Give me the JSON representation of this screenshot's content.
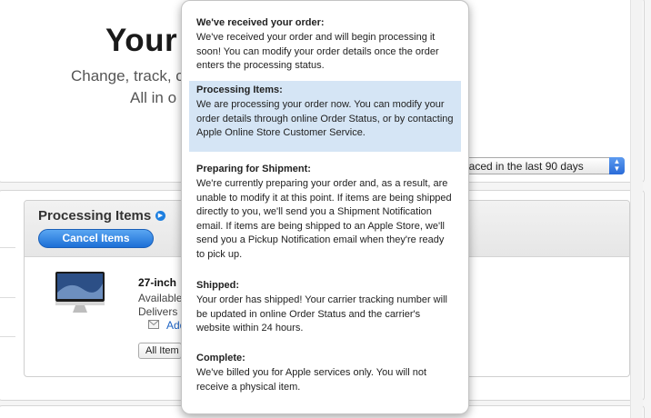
{
  "header": {
    "title": "Your O",
    "subtitle_line1": "Change, track, c",
    "subtitle_line2": "All in o",
    "filter_value": "laced in the last 90 days"
  },
  "order": {
    "status_title": "Processing Items",
    "cancel_label": "Cancel Items",
    "product_name": "27-inch",
    "availability": "Available",
    "delivers": "Delivers",
    "address_link": "Add",
    "items_select": "All Item"
  },
  "popover": {
    "sections": [
      {
        "heading": "We've received your order:",
        "text": "We've received your order and will begin processing it soon! You can modify your order details once the order enters the processing status."
      },
      {
        "heading": "Processing Items:",
        "text": "We are processing your order now. You can modify your order details through online Order Status, or by contacting Apple Online Store Customer Service."
      },
      {
        "heading": "Preparing for Shipment:",
        "text": "We're currently preparing your order and, as a result, are unable to modify it at this point. If items are being shipped directly to you, we'll send you a Shipment Notification email. If items are being shipped to an Apple Store, we'll send you a Pickup Notification email when they're ready to pick up."
      },
      {
        "heading": "Shipped:",
        "text": "Your order has shipped! Your carrier tracking number will be updated in online Order Status and the carrier's website within 24 hours."
      },
      {
        "heading": "Complete:",
        "text": "We've billed you for Apple services only. You will not receive a physical item."
      }
    ]
  },
  "colors": {
    "accent": "#1d7fe0",
    "highlight": "#d5e5f5"
  }
}
